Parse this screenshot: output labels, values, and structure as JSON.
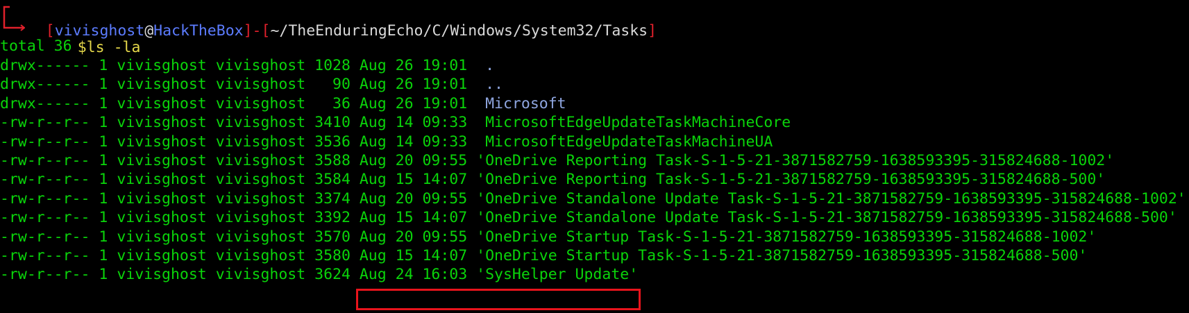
{
  "prompt": {
    "user": "vivisghost",
    "at": "@",
    "host": "HackTheBox",
    "dash": "-",
    "path": "~/TheEnduringEcho/C/Windows/System32/Tasks",
    "symbol": "$",
    "command": "ls -la"
  },
  "output": {
    "total": "total 36",
    "rows": [
      {
        "perms": "drwx------",
        "links": "1",
        "owner": "vivisghost",
        "group": "vivisghost",
        "size": "1028",
        "date": "Aug 26 19:01",
        "name": " .",
        "type": "dir"
      },
      {
        "perms": "drwx------",
        "links": "1",
        "owner": "vivisghost",
        "group": "vivisghost",
        "size": "  90",
        "date": "Aug 26 19:01",
        "name": " ..",
        "type": "dir"
      },
      {
        "perms": "drwx------",
        "links": "1",
        "owner": "vivisghost",
        "group": "vivisghost",
        "size": "  36",
        "date": "Aug 26 19:01",
        "name": " Microsoft",
        "type": "dir"
      },
      {
        "perms": "-rw-r--r--",
        "links": "1",
        "owner": "vivisghost",
        "group": "vivisghost",
        "size": "3410",
        "date": "Aug 14 09:33",
        "name": " MicrosoftEdgeUpdateTaskMachineCore",
        "type": "file"
      },
      {
        "perms": "-rw-r--r--",
        "links": "1",
        "owner": "vivisghost",
        "group": "vivisghost",
        "size": "3536",
        "date": "Aug 14 09:33",
        "name": " MicrosoftEdgeUpdateTaskMachineUA",
        "type": "file"
      },
      {
        "perms": "-rw-r--r--",
        "links": "1",
        "owner": "vivisghost",
        "group": "vivisghost",
        "size": "3588",
        "date": "Aug 20 09:55",
        "name": "'OneDrive Reporting Task-S-1-5-21-3871582759-1638593395-315824688-1002'",
        "type": "file"
      },
      {
        "perms": "-rw-r--r--",
        "links": "1",
        "owner": "vivisghost",
        "group": "vivisghost",
        "size": "3584",
        "date": "Aug 15 14:07",
        "name": "'OneDrive Reporting Task-S-1-5-21-3871582759-1638593395-315824688-500'",
        "type": "file"
      },
      {
        "perms": "-rw-r--r--",
        "links": "1",
        "owner": "vivisghost",
        "group": "vivisghost",
        "size": "3374",
        "date": "Aug 20 09:55",
        "name": "'OneDrive Standalone Update Task-S-1-5-21-3871582759-1638593395-315824688-1002'",
        "type": "file"
      },
      {
        "perms": "-rw-r--r--",
        "links": "1",
        "owner": "vivisghost",
        "group": "vivisghost",
        "size": "3392",
        "date": "Aug 15 14:07",
        "name": "'OneDrive Standalone Update Task-S-1-5-21-3871582759-1638593395-315824688-500'",
        "type": "file"
      },
      {
        "perms": "-rw-r--r--",
        "links": "1",
        "owner": "vivisghost",
        "group": "vivisghost",
        "size": "3570",
        "date": "Aug 20 09:55",
        "name": "'OneDrive Startup Task-S-1-5-21-3871582759-1638593395-315824688-1002'",
        "type": "file"
      },
      {
        "perms": "-rw-r--r--",
        "links": "1",
        "owner": "vivisghost",
        "group": "vivisghost",
        "size": "3580",
        "date": "Aug 15 14:07",
        "name": "'OneDrive Startup Task-S-1-5-21-3871582759-1638593395-315824688-500'",
        "type": "file"
      },
      {
        "perms": "-rw-r--r--",
        "links": "1",
        "owner": "vivisghost",
        "group": "vivisghost",
        "size": "3624",
        "date": "Aug 24 16:03",
        "name": "'SysHelper Update'",
        "type": "file"
      }
    ]
  },
  "colors": {
    "background": "#000000",
    "text_green": "#00e000",
    "prompt_red": "#e0202b",
    "prompt_blue": "#5c7cff",
    "command_yellow": "#e5d84a",
    "directory": "#8fa6e0",
    "highlight_border": "#e8141c"
  }
}
